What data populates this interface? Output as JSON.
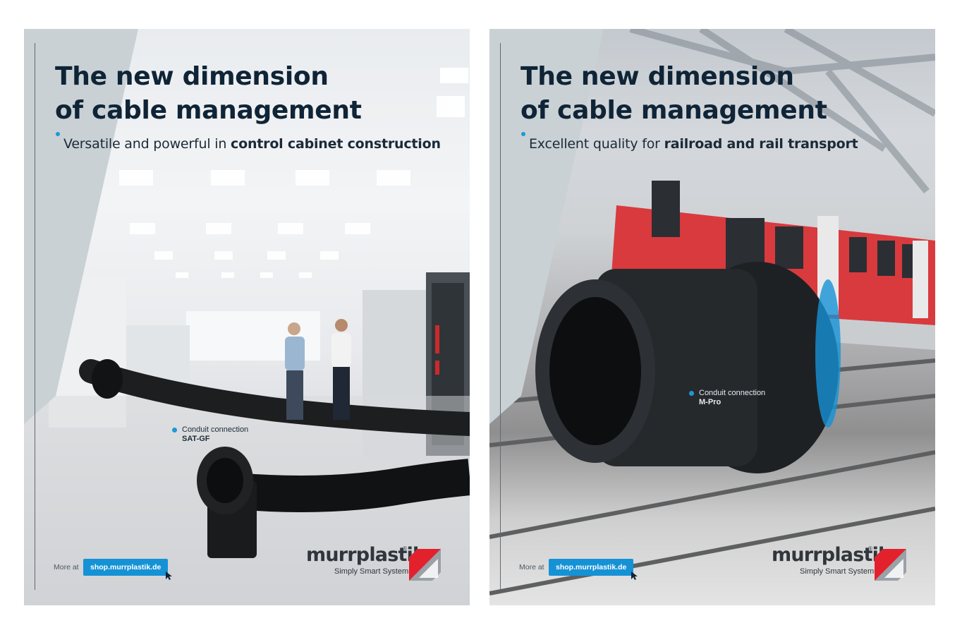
{
  "posters": [
    {
      "headline": [
        "The new dimension",
        "of cable management"
      ],
      "subline_regular": "Versatile and powerful in ",
      "subline_bold": "control cabinet construction",
      "callout_label": "Conduit connection",
      "callout_product": "SAT-GF",
      "more_at": "More at",
      "url": "shop.murrplastik.de",
      "brand": "murrplastik",
      "registered": "®",
      "tagline": "Simply Smart Systems"
    },
    {
      "headline": [
        "The new dimension",
        "of cable management"
      ],
      "subline_regular": "Excellent quality for ",
      "subline_bold": "railroad and rail transport",
      "callout_label": "Conduit connection",
      "callout_product": "M-Pro",
      "more_at": "More at",
      "url": "shop.murrplastik.de",
      "brand": "murrplastik",
      "registered": "®",
      "tagline": "Simply Smart Systems"
    }
  ],
  "colors": {
    "headline": "#0f2436",
    "accent_blue": "#1592d6",
    "logo_red": "#e3212d",
    "logo_grey": "#9aa1a7",
    "wedge": "#c9d1d5"
  },
  "icons": [
    "cursor-icon",
    "murrplastik-logo-mark"
  ]
}
